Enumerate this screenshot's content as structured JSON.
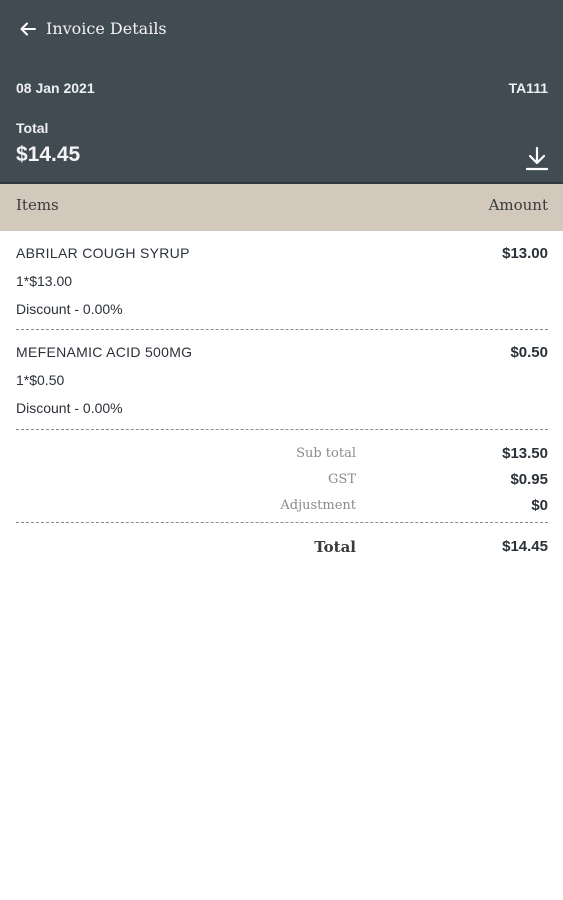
{
  "header": {
    "title": "Invoice Details",
    "back_icon": "arrow-left-icon",
    "date": "08 Jan 2021",
    "reference": "TA111",
    "total_label": "Total",
    "total_value": "$14.45",
    "download_icon": "download-icon"
  },
  "table": {
    "col_items": "Items",
    "col_amount": "Amount",
    "rows": [
      {
        "name": "ABRILAR COUGH SYRUP",
        "amount": "$13.00",
        "qty": "1*$13.00",
        "discount": "Discount - 0.00%"
      },
      {
        "name": "MEFENAMIC ACID 500MG",
        "amount": "$0.50",
        "qty": "1*$0.50",
        "discount": "Discount - 0.00%"
      }
    ]
  },
  "summary": {
    "subtotal_label": "Sub total",
    "subtotal_value": "$13.50",
    "gst_label": "GST",
    "gst_value": "$0.95",
    "adjustment_label": "Adjustment",
    "adjustment_value": "$0",
    "total_label": "Total",
    "total_value": "$14.45"
  },
  "colors": {
    "header_bg": "#414b52",
    "table_head_bg": "#d2c9bc"
  }
}
